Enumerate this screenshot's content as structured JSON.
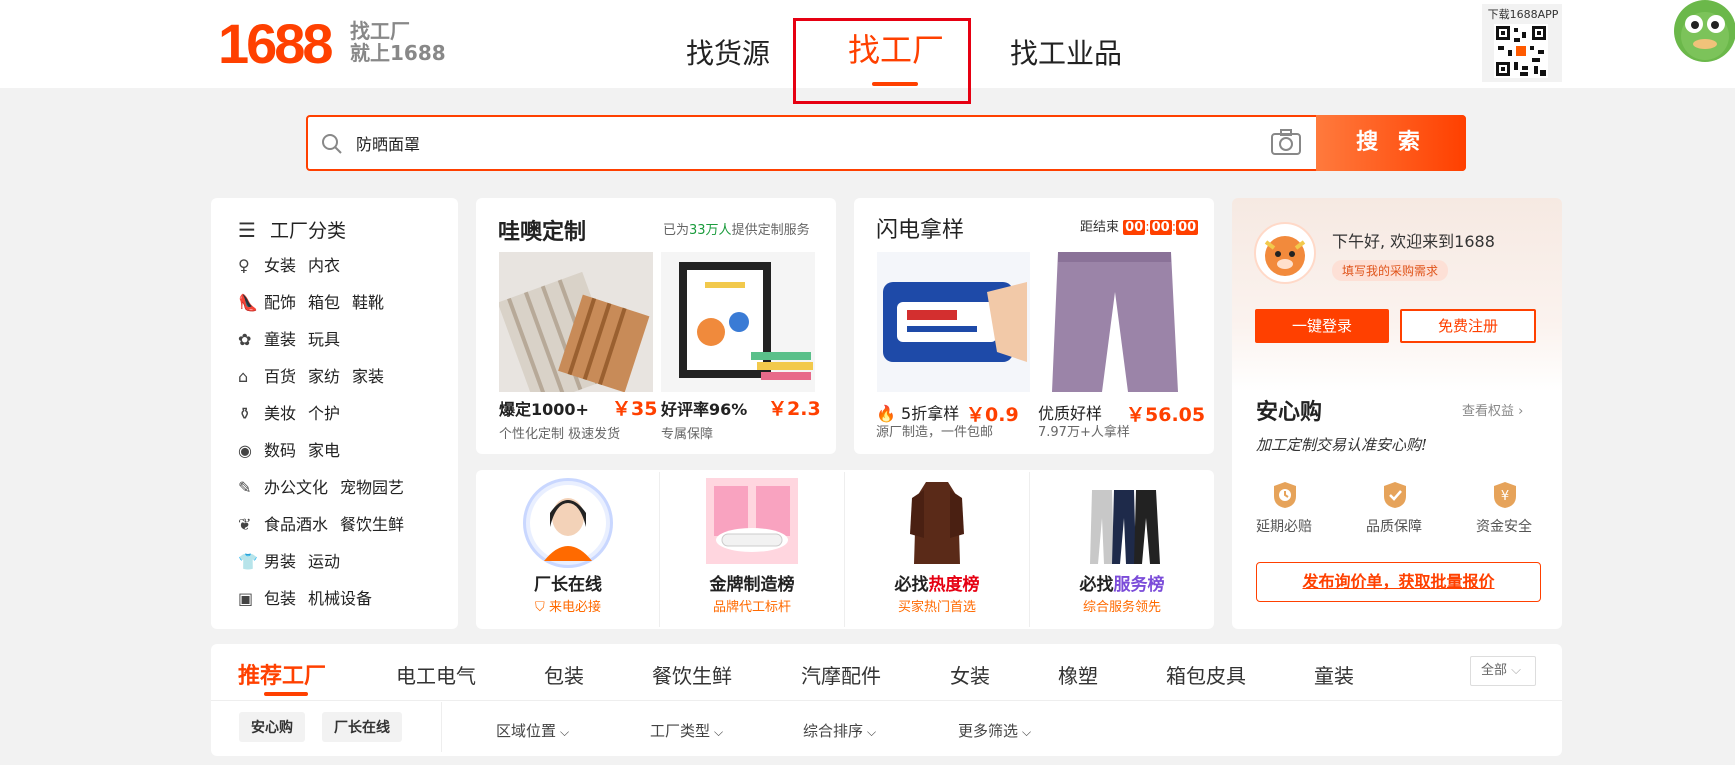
{
  "header": {
    "logo_number": "1688",
    "logo_tagline_1": "找工厂",
    "logo_tagline_2": "就上1688",
    "nav_tabs": [
      "找货源",
      "找工厂",
      "找工业品"
    ],
    "qr_label": "下载1688APP"
  },
  "search": {
    "value": "防晒面罩",
    "button_label": "搜 索"
  },
  "categories": {
    "title": "工厂分类",
    "rows": [
      {
        "icon": "dress-icon",
        "items": [
          "女装",
          "内衣"
        ]
      },
      {
        "icon": "heel-icon",
        "items": [
          "配饰",
          "箱包",
          "鞋靴"
        ]
      },
      {
        "icon": "toy-icon",
        "items": [
          "童装",
          "玩具"
        ]
      },
      {
        "icon": "store-icon",
        "items": [
          "百货",
          "家纺",
          "家装"
        ]
      },
      {
        "icon": "bottle-icon",
        "items": [
          "美妆",
          "个护"
        ]
      },
      {
        "icon": "camera-icon",
        "items": [
          "数码",
          "家电"
        ]
      },
      {
        "icon": "pet-icon",
        "items": [
          "办公文化",
          "宠物园艺"
        ]
      },
      {
        "icon": "apple-icon",
        "items": [
          "食品酒水",
          "餐饮生鲜"
        ]
      },
      {
        "icon": "shirt-icon",
        "items": [
          "男装",
          "运动"
        ]
      },
      {
        "icon": "package-icon",
        "items": [
          "包装",
          "机械设备"
        ]
      }
    ]
  },
  "custom_card": {
    "title": "哇噢定制",
    "note_prefix": "已为",
    "note_count": "33万人",
    "note_suffix": "提供定制服务",
    "items": [
      {
        "label": "爆定1000+",
        "price": "￥35",
        "desc": "个性化定制 极速发货"
      },
      {
        "label": "好评率96%",
        "price": "￥2.3",
        "desc": "专属保障"
      }
    ]
  },
  "flash_card": {
    "title": "闪电拿样",
    "countdown_label": "距结束",
    "countdown": [
      "00",
      "00",
      "00"
    ],
    "items": [
      {
        "label": "5折拿样",
        "price": "￥0.9",
        "desc": "源厂制造，一件包邮"
      },
      {
        "label": "优质好样",
        "price": "￥56.05",
        "desc": "7.97万+人拿样"
      }
    ]
  },
  "bottom_cards": [
    {
      "title": "厂长在线",
      "sub": "来电必接",
      "title_highlight": ""
    },
    {
      "title": "金牌制造榜",
      "sub": "品牌代工标杆",
      "title_highlight": ""
    },
    {
      "title_prefix": "必找",
      "title_highlight": "热度榜",
      "sub": "买家热门首选"
    },
    {
      "title_prefix": "必找",
      "title_highlight": "服务榜",
      "sub": "综合服务领先"
    }
  ],
  "user_panel": {
    "greeting": "下午好, 欢迎来到1688",
    "pill": "填写我的采购需求",
    "login_label": "一键登录",
    "register_label": "免费注册",
    "anxingou_title": "安心购",
    "rights_link": "查看权益 ›",
    "slogan": "加工定制交易认准安心购!",
    "badges": [
      "延期必赔",
      "品质保障",
      "资金安全"
    ],
    "cta": "发布询价单，获取批量报价"
  },
  "factory_tabs": {
    "items": [
      "推荐工厂",
      "电工电气",
      "包装",
      "餐饮生鲜",
      "汽摩配件",
      "女装",
      "橡塑",
      "箱包皮具",
      "童装"
    ],
    "all_label": "全部"
  },
  "filters": {
    "tags": [
      "安心购",
      "厂长在线"
    ],
    "dropdowns": [
      "区域位置",
      "工厂类型",
      "综合排序",
      "更多筛选"
    ]
  },
  "colors": {
    "brand": "#ff4000",
    "highlight_box": "#e60012",
    "green": "#1a9b3c",
    "purple": "#7b4cd9"
  }
}
